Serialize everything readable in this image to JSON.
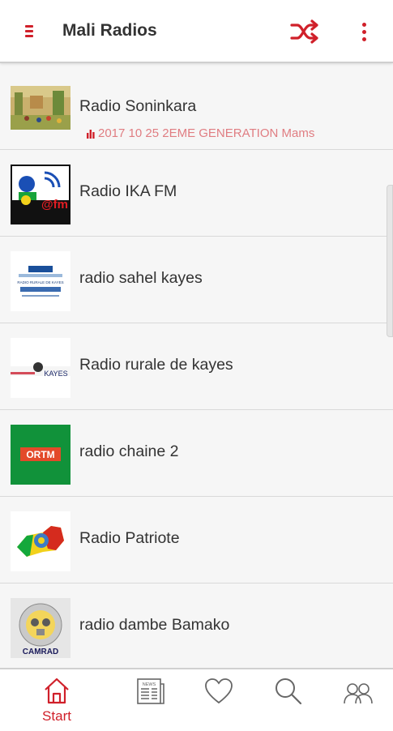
{
  "appbar": {
    "title": "Mali Radios",
    "accent": "#d0202a",
    "icons": [
      "menu-icon",
      "shuffle-icon",
      "more-vertical-icon"
    ]
  },
  "stations": [
    {
      "name": "Radio Soninkara",
      "now_playing": "2017 10 25 2EME GENERATION Mams"
    },
    {
      "name": "Radio IKA FM",
      "logo_text": "@fm"
    },
    {
      "name": "radio sahel kayes",
      "logo_text": "RADIO RURALE DE KAYES"
    },
    {
      "name": "Radio rurale de kayes",
      "logo_text": "KAYES"
    },
    {
      "name": "radio chaine 2",
      "logo_text": "ORTM"
    },
    {
      "name": "Radio Patriote"
    },
    {
      "name": "radio dambe Bamako",
      "logo_text": "CAMRAD"
    }
  ],
  "bottom_nav": [
    {
      "label": "Start",
      "icon": "home-icon",
      "active": true
    },
    {
      "label": "",
      "icon": "news-icon",
      "logo_text": "NEWS"
    },
    {
      "label": "",
      "icon": "heart-icon"
    },
    {
      "label": "",
      "icon": "search-icon"
    },
    {
      "label": "",
      "icon": "users-icon"
    }
  ]
}
